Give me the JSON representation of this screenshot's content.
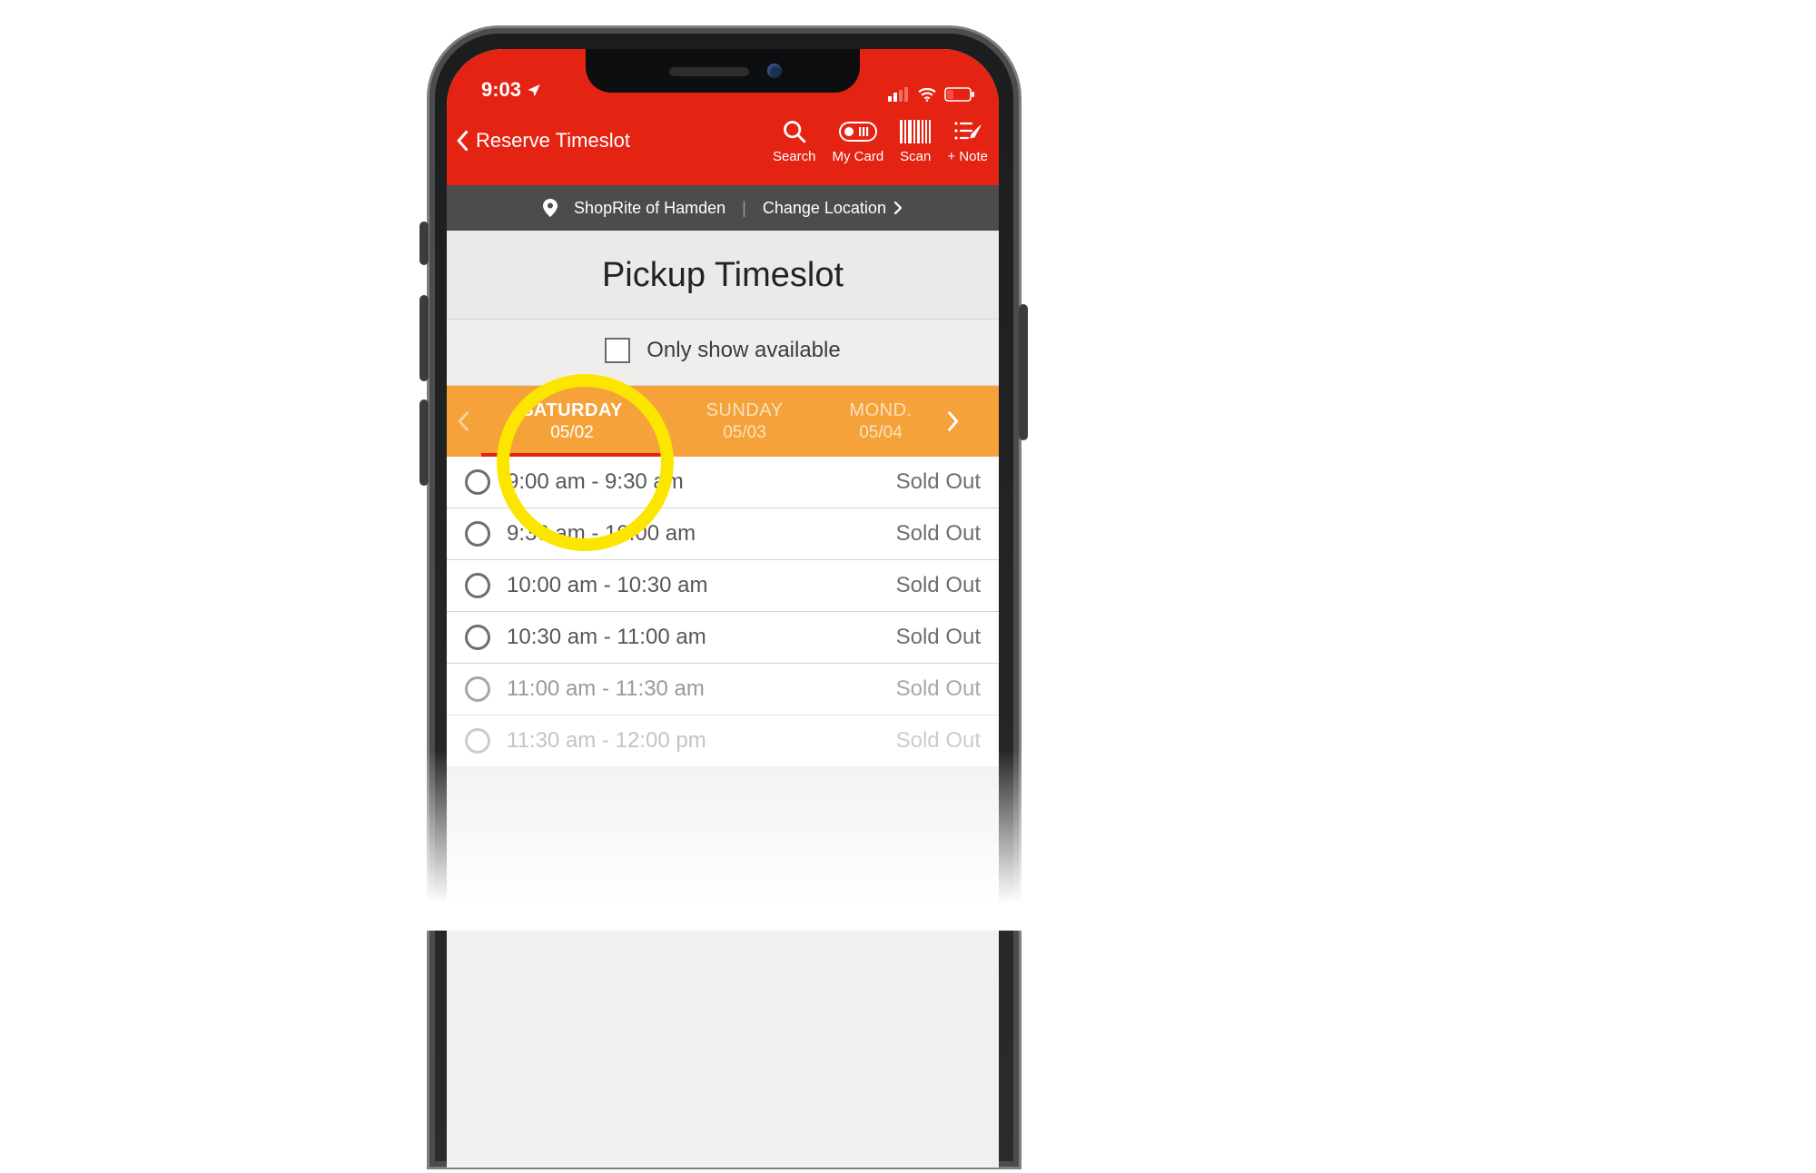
{
  "status": {
    "time": "9:03",
    "location_icon": "location-arrow-icon",
    "signal_icon": "cellular-icon",
    "wifi_icon": "wifi-icon",
    "battery_icon": "battery-low-icon"
  },
  "nav": {
    "back_label": "Reserve Timeslot",
    "actions": {
      "search": "Search",
      "my_card": "My Card",
      "scan": "Scan",
      "note": "+ Note"
    }
  },
  "location": {
    "store_name": "ShopRite of Hamden",
    "change_label": "Change Location"
  },
  "title": "Pickup Timeslot",
  "filter": {
    "only_available_label": "Only show available",
    "checked": false
  },
  "day_tabs": {
    "prev_icon": "chevron-left-icon",
    "next_icon": "chevron-right-icon",
    "selected_index": 0,
    "days": [
      {
        "name": "SATURDAY",
        "date": "05/02"
      },
      {
        "name": "SUNDAY",
        "date": "05/03"
      },
      {
        "name": "MOND.",
        "date": "05/04"
      }
    ]
  },
  "slots": [
    {
      "time": "9:00 am - 9:30 am",
      "status": "Sold Out"
    },
    {
      "time": "9:30 am - 10:00 am",
      "status": "Sold Out"
    },
    {
      "time": "10:00 am - 10:30 am",
      "status": "Sold Out"
    },
    {
      "time": "10:30 am - 11:00 am",
      "status": "Sold Out"
    },
    {
      "time": "11:00 am - 11:30 am",
      "status": "Sold Out"
    },
    {
      "time": "11:30 am - 12:00 pm",
      "status": "Sold Out"
    }
  ],
  "colors": {
    "brand_red": "#e42313",
    "day_tab_orange": "#f5a23b",
    "highlight_yellow": "#fce600"
  }
}
